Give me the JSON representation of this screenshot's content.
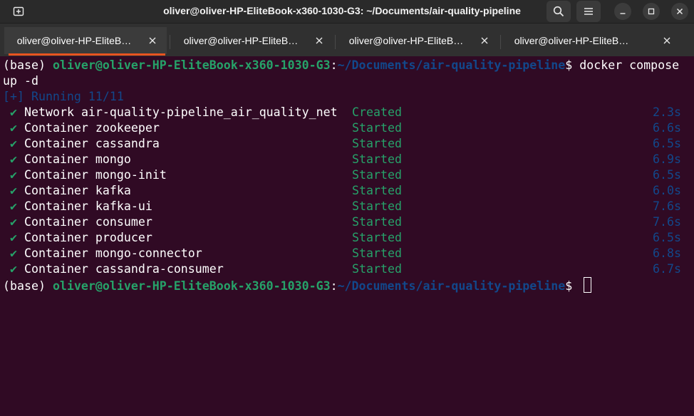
{
  "window": {
    "title": "oliver@oliver-HP-EliteBook-x360-1030-G3: ~/Documents/air-quality-pipeline"
  },
  "headerbar": {
    "new_tab_icon": "new-tab-icon",
    "search_icon": "search-icon",
    "menu_icon": "hamburger-menu-icon",
    "minimize_icon": "minimize-icon",
    "maximize_icon": "maximize-icon",
    "close_icon": "close-icon"
  },
  "tabs": [
    {
      "label": "oliver@oliver-HP-EliteB…",
      "active": true
    },
    {
      "label": "oliver@oliver-HP-EliteB…",
      "active": false
    },
    {
      "label": "oliver@oliver-HP-EliteB…",
      "active": false
    },
    {
      "label": "oliver@oliver-HP-EliteB…",
      "active": false
    }
  ],
  "terminal": {
    "prompt": {
      "env": "(base) ",
      "user": "oliver@oliver-HP-EliteBook-x360-1030-G3",
      "sep": ":",
      "path": "~/Documents/air-quality-pipeline",
      "dollar": "$ "
    },
    "command": "docker compose",
    "command_wrap": "up -d",
    "running": "[+] Running 11/11",
    "check_mark": "✔",
    "entries": [
      {
        "kind": "Network",
        "name": "air-quality-pipeline_air_quality_net",
        "status": "Created",
        "time": "2.3s"
      },
      {
        "kind": "Container",
        "name": "zookeeper",
        "status": "Started",
        "time": "6.6s"
      },
      {
        "kind": "Container",
        "name": "cassandra",
        "status": "Started",
        "time": "6.5s"
      },
      {
        "kind": "Container",
        "name": "mongo",
        "status": "Started",
        "time": "6.9s"
      },
      {
        "kind": "Container",
        "name": "mongo-init",
        "status": "Started",
        "time": "6.5s"
      },
      {
        "kind": "Container",
        "name": "kafka",
        "status": "Started",
        "time": "6.0s"
      },
      {
        "kind": "Container",
        "name": "kafka-ui",
        "status": "Started",
        "time": "7.6s"
      },
      {
        "kind": "Container",
        "name": "consumer",
        "status": "Started",
        "time": "7.6s"
      },
      {
        "kind": "Container",
        "name": "producer",
        "status": "Started",
        "time": "6.5s"
      },
      {
        "kind": "Container",
        "name": "mongo-connector",
        "status": "Started",
        "time": "6.8s"
      },
      {
        "kind": "Container",
        "name": "cassandra-consumer",
        "status": "Started",
        "time": "6.7s"
      }
    ]
  },
  "colors": {
    "background": "#300a24",
    "prompt_user": "#26a269",
    "prompt_path": "#12488b",
    "accent_tab": "#e95420"
  }
}
